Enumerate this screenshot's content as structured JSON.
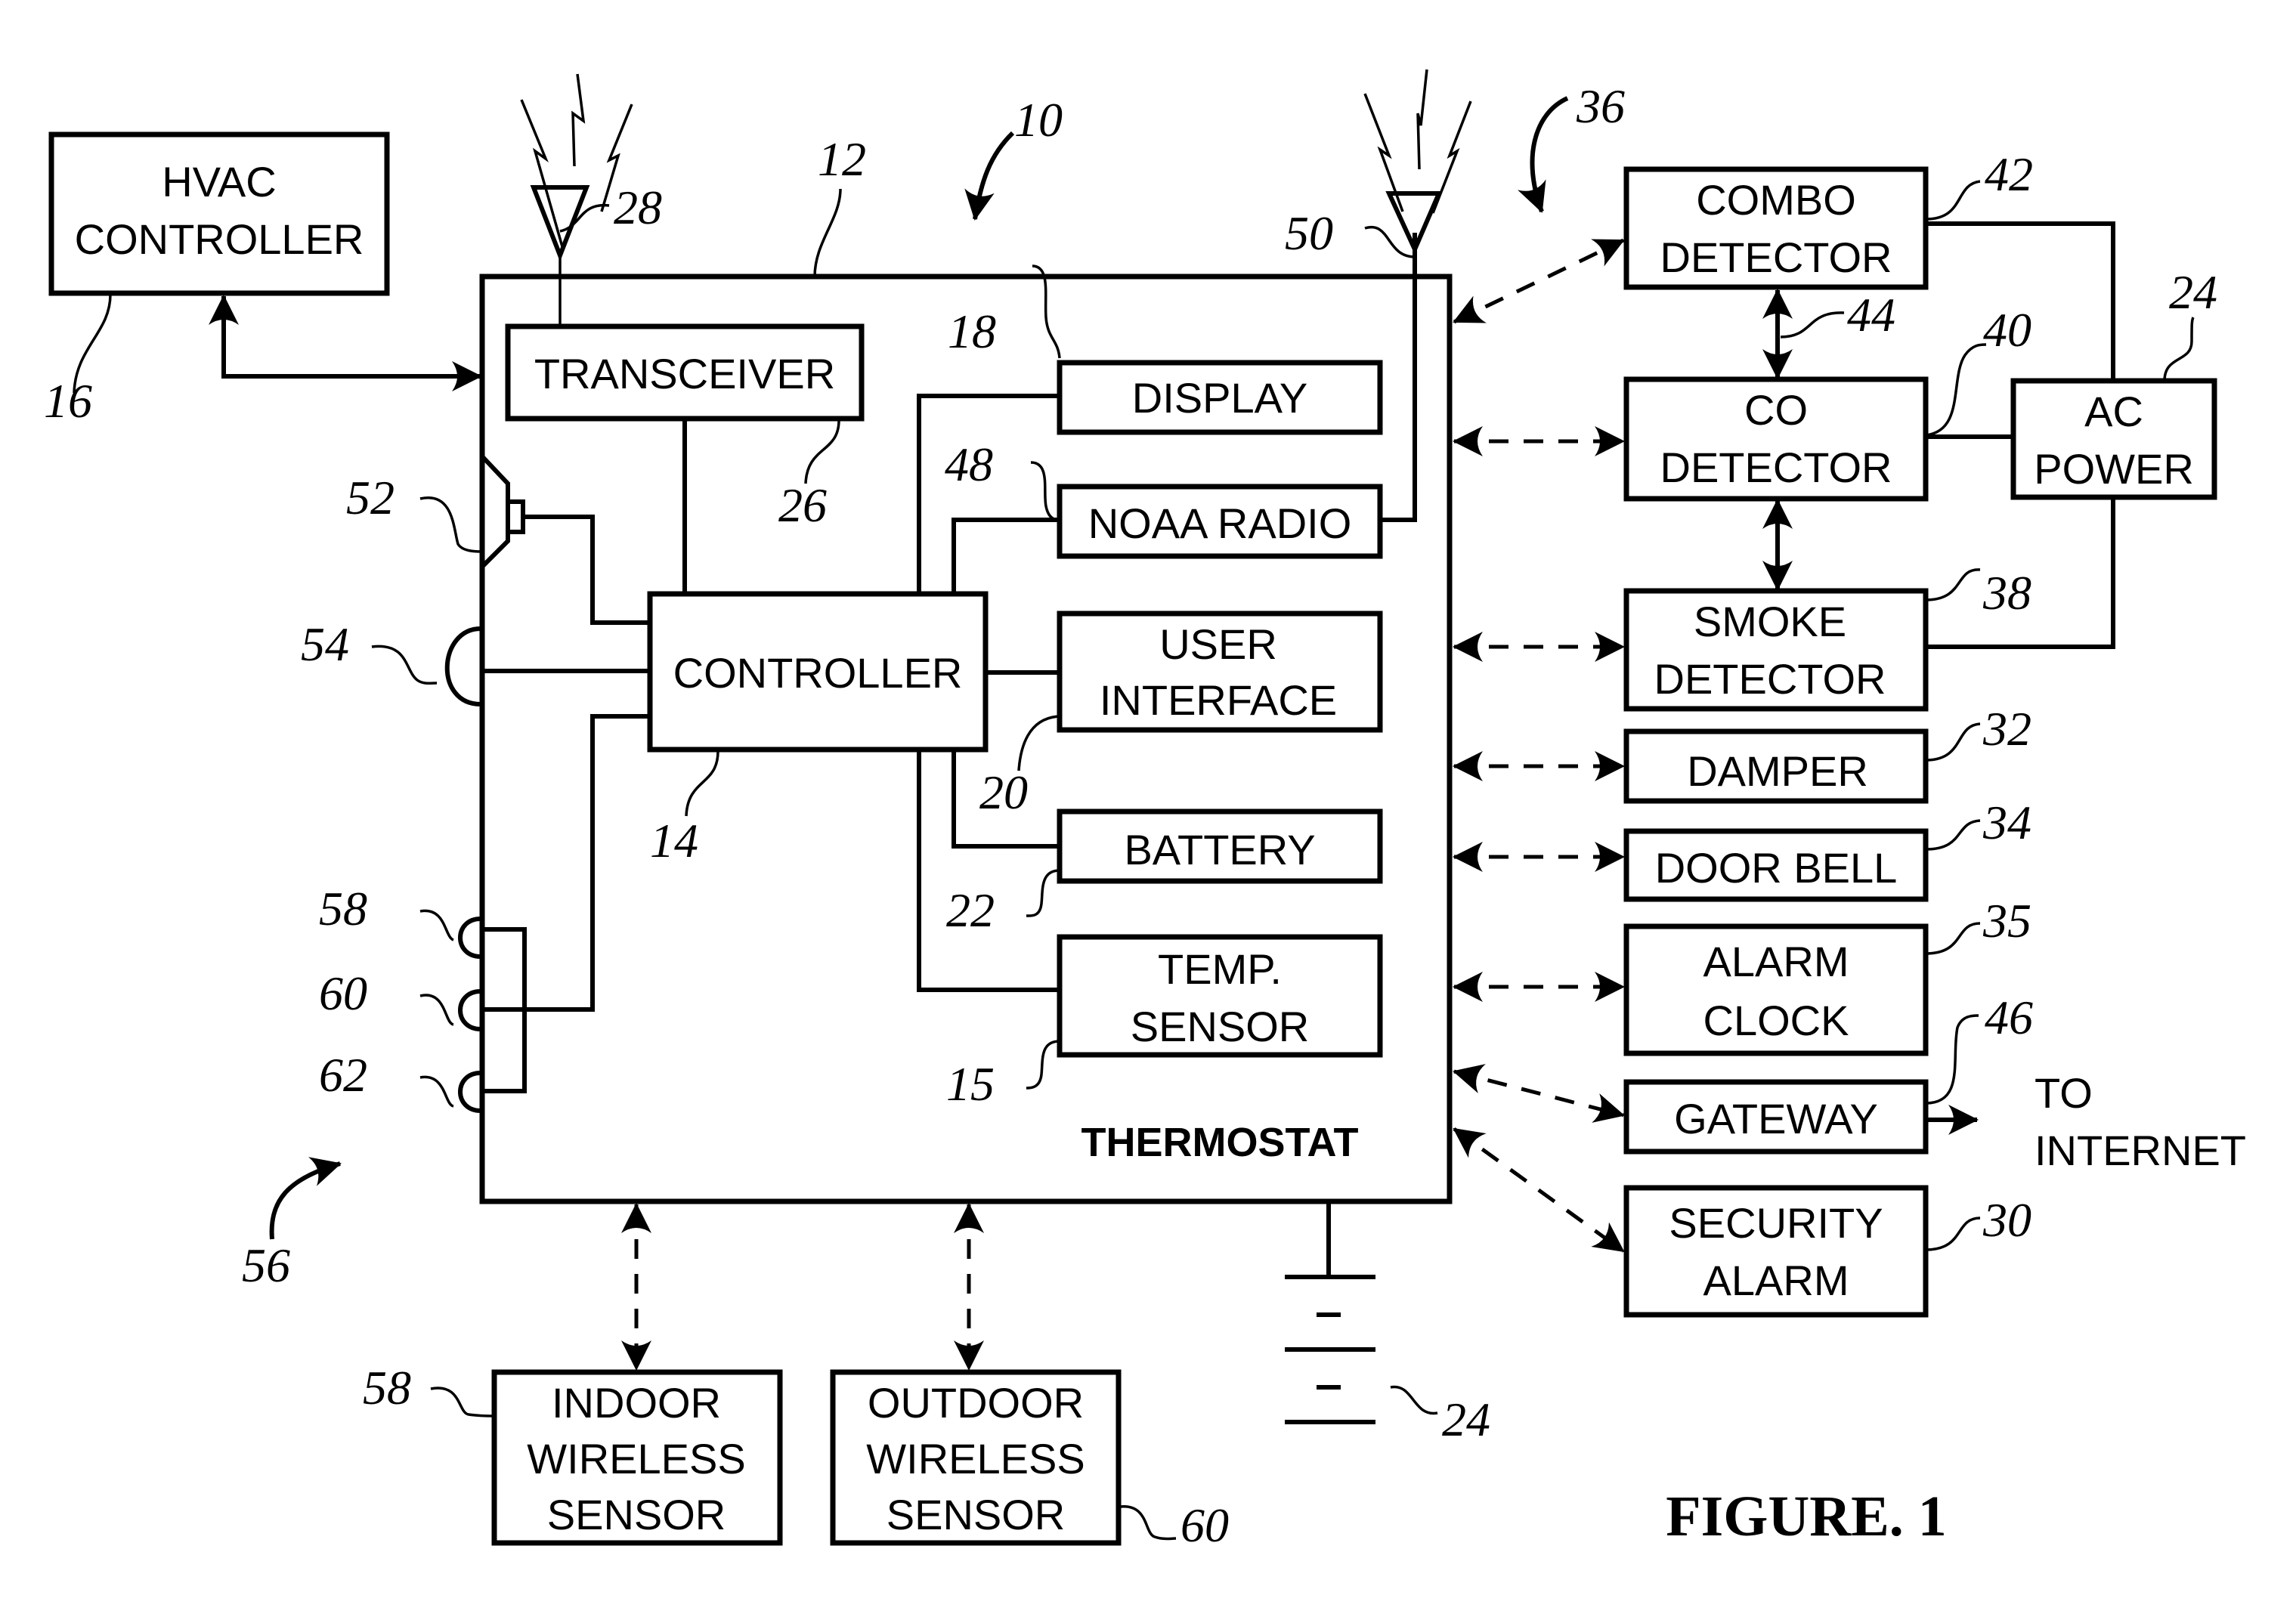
{
  "figure_title": "FIGURE. 1",
  "thermostat": {
    "label": "THERMOSTAT",
    "ref": "12",
    "system_ref": "10"
  },
  "blocks": {
    "hvac_controller": {
      "lines": [
        "HVAC",
        "CONTROLLER"
      ],
      "ref": "16"
    },
    "transceiver": {
      "lines": [
        "TRANSCEIVER"
      ],
      "ref": "26"
    },
    "controller": {
      "lines": [
        "CONTROLLER"
      ],
      "ref": "14"
    },
    "display": {
      "lines": [
        "DISPLAY"
      ],
      "ref": "18"
    },
    "noaa_radio": {
      "lines": [
        "NOAA RADIO"
      ],
      "ref": "48"
    },
    "user_interface": {
      "lines": [
        "USER",
        "INTERFACE"
      ],
      "ref": "20"
    },
    "battery": {
      "lines": [
        "BATTERY"
      ],
      "ref": "22"
    },
    "temp_sensor": {
      "lines": [
        "TEMP.",
        "SENSOR"
      ],
      "ref": "15"
    },
    "combo_detector": {
      "lines": [
        "COMBO",
        "DETECTOR"
      ],
      "ref": "42"
    },
    "co_detector": {
      "lines": [
        "CO",
        "DETECTOR"
      ],
      "ref": "40"
    },
    "ac_power": {
      "lines": [
        "AC",
        "POWER"
      ],
      "ref": "24"
    },
    "smoke_detector": {
      "lines": [
        "SMOKE",
        "DETECTOR"
      ],
      "ref": "38"
    },
    "damper": {
      "lines": [
        "DAMPER"
      ],
      "ref": "32"
    },
    "door_bell": {
      "lines": [
        "DOOR BELL"
      ],
      "ref": "34"
    },
    "alarm_clock": {
      "lines": [
        "ALARM",
        "CLOCK"
      ],
      "ref": "35"
    },
    "gateway": {
      "lines": [
        "GATEWAY"
      ],
      "ref": "46"
    },
    "security_alarm": {
      "lines": [
        "SECURITY",
        "ALARM"
      ],
      "ref": "30"
    },
    "indoor_wireless_sensor": {
      "lines": [
        "INDOOR",
        "WIRELESS",
        "SENSOR"
      ],
      "ref": "58"
    },
    "outdoor_wireless_sensor": {
      "lines": [
        "OUTDOOR",
        "WIRELESS",
        "SENSOR"
      ],
      "ref": "60"
    }
  },
  "to_internet": {
    "lines": [
      "TO",
      "INTERNET"
    ]
  },
  "refs": {
    "antenna_transceiver": "28",
    "antenna_noaa": "50",
    "speaker": "52",
    "connector_54": "54",
    "connector_58": "58",
    "connector_60": "60",
    "connector_62": "62",
    "connector_group": "56",
    "detector_link": "44",
    "external_group": "36",
    "ground_power": "24",
    "ac_power": "24"
  }
}
